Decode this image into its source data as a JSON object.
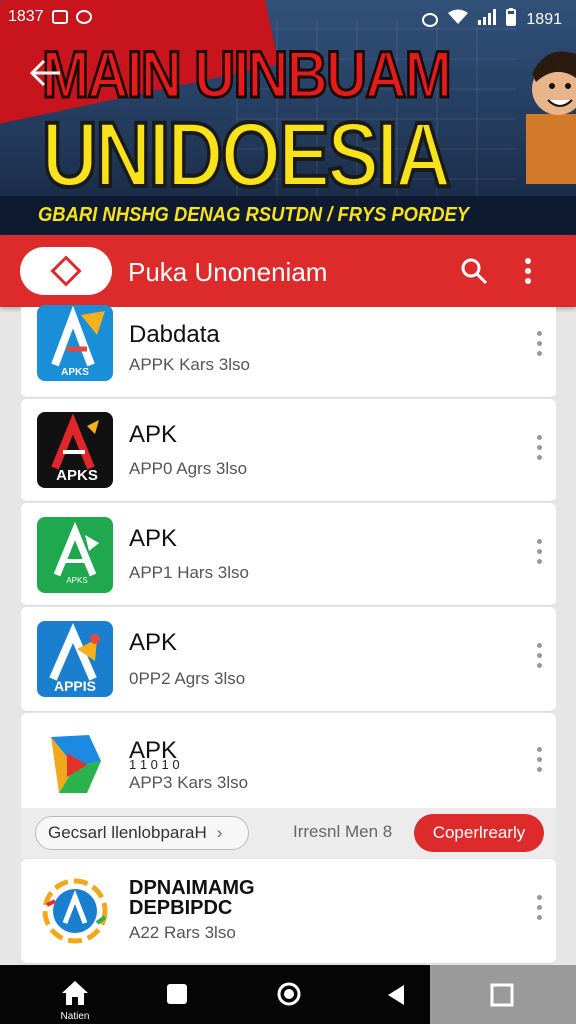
{
  "status_bar": {
    "time": "1837",
    "right_text": "1891"
  },
  "banner": {
    "title_line1": "MAIN UINBUAM",
    "title_line2": "UNIDOESIA",
    "subtitle": "GBARI NHSHG DENAG RSUTDN / FRYS PORDEY"
  },
  "app_bar": {
    "title": "Puka Unoneniam"
  },
  "apps": [
    {
      "name": "Dabdata",
      "meta": "APPK Kars 3lso",
      "icon": "apks-blue-icon",
      "color": "#1a8ed6"
    },
    {
      "name": "APK",
      "meta": "APP0 Agrs 3lso",
      "icon": "apks-black-icon",
      "color": "#111111"
    },
    {
      "name": "APK",
      "meta": "APP1 Hars 3lso",
      "icon": "apks-green-icon",
      "color": "#1fa84d"
    },
    {
      "name": "APK",
      "meta": "0PP2 Agrs 3lso",
      "icon": "apps-blue-icon",
      "color": "#1b7fcf"
    },
    {
      "name": "APK",
      "name_extra": "1 1 0 1 0",
      "meta": "APP3 Kars 3lso",
      "icon": "play-multicolor-icon",
      "color": "#ffffff"
    },
    {
      "name": "DPNAIMAMG",
      "name_line2": "DEPBIPDC",
      "meta": "A22 Rars 3lso",
      "icon": "round-badge-icon",
      "color": "#ffffff"
    }
  ],
  "promo": {
    "chip_label": "Gecsarl llenlobparaH",
    "middle_text": "Irresnl Men 8",
    "button_label": "Coperlrearly"
  },
  "nav": {
    "home_label": "Natien"
  }
}
